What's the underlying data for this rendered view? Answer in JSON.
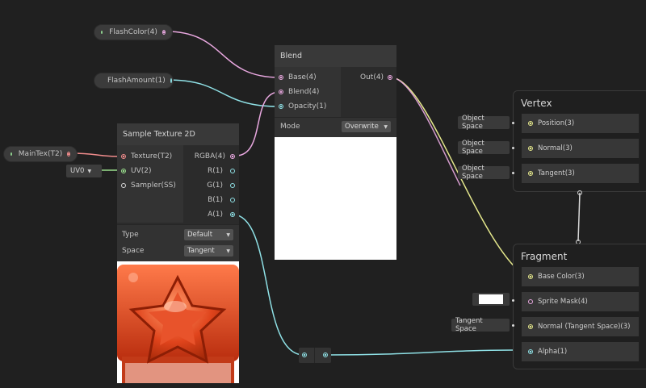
{
  "properties": {
    "flash_color": "FlashColor(4)",
    "flash_amount": "FlashAmount(1)",
    "main_tex": "MainTex(T2)"
  },
  "uv_chip": {
    "value": "UV0"
  },
  "blend_node": {
    "title": "Blend",
    "inputs": [
      "Base(4)",
      "Blend(4)",
      "Opacity(1)"
    ],
    "output": "Out(4)",
    "mode_label": "Mode",
    "mode_value": "Overwrite"
  },
  "sample_node": {
    "title": "Sample Texture 2D",
    "inputs": [
      "Texture(T2)",
      "UV(2)",
      "Sampler(SS)"
    ],
    "outputs": [
      "RGBA(4)",
      "R(1)",
      "G(1)",
      "B(1)",
      "A(1)"
    ],
    "type_label": "Type",
    "type_value": "Default",
    "space_label": "Space",
    "space_value": "Tangent"
  },
  "vertex": {
    "title": "Vertex",
    "blocks": [
      "Position(3)",
      "Normal(3)",
      "Tangent(3)"
    ],
    "chips": [
      "Object Space",
      "Object Space",
      "Object Space"
    ]
  },
  "fragment": {
    "title": "Fragment",
    "blocks": [
      "Base Color(3)",
      "Sprite Mask(4)",
      "Normal (Tangent Space)(3)",
      "Alpha(1)"
    ],
    "normal_chip": "Tangent Space"
  },
  "colors": {
    "background": "#202020",
    "vector4_port": "#e9a8e0",
    "float_port": "#8fe1e6",
    "texture_port": "#f08c8c",
    "vector3_port": "#e5e88c",
    "vector2_port": "#9be08e",
    "texture_preview_accent": "#e0441c"
  }
}
